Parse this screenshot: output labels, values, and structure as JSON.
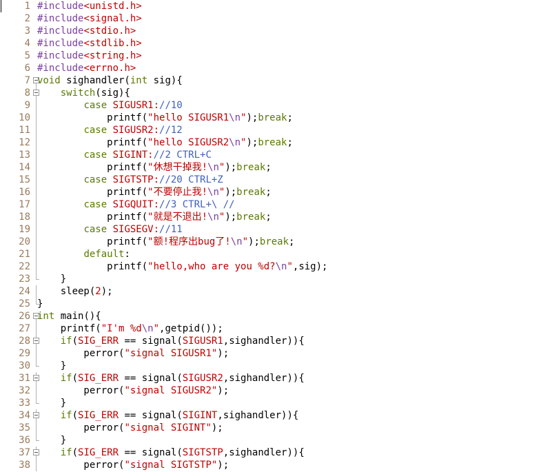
{
  "editor": {
    "lines": [
      {
        "n": "1",
        "tokens": [
          {
            "t": "#include",
            "c": "pp"
          },
          {
            "t": "<unistd.h>",
            "c": "inc"
          }
        ]
      },
      {
        "n": "2",
        "tokens": [
          {
            "t": "#include",
            "c": "pp"
          },
          {
            "t": "<signal.h>",
            "c": "inc"
          }
        ]
      },
      {
        "n": "3",
        "tokens": [
          {
            "t": "#include",
            "c": "pp"
          },
          {
            "t": "<stdio.h>",
            "c": "inc"
          }
        ]
      },
      {
        "n": "4",
        "tokens": [
          {
            "t": "#include",
            "c": "pp"
          },
          {
            "t": "<stdlib.h>",
            "c": "inc"
          }
        ]
      },
      {
        "n": "5",
        "tokens": [
          {
            "t": "#include",
            "c": "pp"
          },
          {
            "t": "<string.h>",
            "c": "inc"
          }
        ]
      },
      {
        "n": "6",
        "tokens": [
          {
            "t": "#include",
            "c": "pp"
          },
          {
            "t": "<errno.h>",
            "c": "inc"
          }
        ]
      },
      {
        "n": "7",
        "tokens": [
          {
            "t": "void",
            "c": "kw"
          },
          {
            "t": " sighandler(",
            "c": ""
          },
          {
            "t": "int",
            "c": "kw"
          },
          {
            "t": " sig){",
            "c": ""
          }
        ]
      },
      {
        "n": "8",
        "tokens": [
          {
            "t": "    ",
            "c": ""
          },
          {
            "t": "switch",
            "c": "kw"
          },
          {
            "t": "(sig){",
            "c": ""
          }
        ]
      },
      {
        "n": "9",
        "tokens": [
          {
            "t": "        ",
            "c": ""
          },
          {
            "t": "case",
            "c": "kw"
          },
          {
            "t": " SIGUSR1:",
            "c": "str"
          },
          {
            "t": "//10",
            "c": "cm"
          }
        ]
      },
      {
        "n": "10",
        "tokens": [
          {
            "t": "            printf(",
            "c": ""
          },
          {
            "t": "\"hello SIGUSR1",
            "c": "str"
          },
          {
            "t": "\\n",
            "c": "esc"
          },
          {
            "t": "\"",
            "c": "str"
          },
          {
            "t": ");",
            "c": ""
          },
          {
            "t": "break",
            "c": "kw"
          },
          {
            "t": ";",
            "c": ""
          }
        ]
      },
      {
        "n": "11",
        "tokens": [
          {
            "t": "        ",
            "c": ""
          },
          {
            "t": "case",
            "c": "kw"
          },
          {
            "t": " SIGUSR2:",
            "c": "str"
          },
          {
            "t": "//12",
            "c": "cm"
          }
        ]
      },
      {
        "n": "12",
        "tokens": [
          {
            "t": "            printf(",
            "c": ""
          },
          {
            "t": "\"hello SIGUSR2",
            "c": "str"
          },
          {
            "t": "\\n",
            "c": "esc"
          },
          {
            "t": "\"",
            "c": "str"
          },
          {
            "t": ");",
            "c": ""
          },
          {
            "t": "break",
            "c": "kw"
          },
          {
            "t": ";",
            "c": ""
          }
        ]
      },
      {
        "n": "13",
        "tokens": [
          {
            "t": "        ",
            "c": ""
          },
          {
            "t": "case",
            "c": "kw"
          },
          {
            "t": " SIGINT:",
            "c": "str"
          },
          {
            "t": "//2 CTRL+C",
            "c": "cm"
          }
        ]
      },
      {
        "n": "14",
        "tokens": [
          {
            "t": "            printf(",
            "c": ""
          },
          {
            "t": "\"休想干掉我!",
            "c": "str"
          },
          {
            "t": "\\n",
            "c": "esc"
          },
          {
            "t": "\"",
            "c": "str"
          },
          {
            "t": ");",
            "c": ""
          },
          {
            "t": "break",
            "c": "kw"
          },
          {
            "t": ";",
            "c": ""
          }
        ]
      },
      {
        "n": "15",
        "tokens": [
          {
            "t": "        ",
            "c": ""
          },
          {
            "t": "case",
            "c": "kw"
          },
          {
            "t": " SIGTSTP:",
            "c": "str"
          },
          {
            "t": "//20 CTRL+Z",
            "c": "cm"
          }
        ]
      },
      {
        "n": "16",
        "tokens": [
          {
            "t": "            printf(",
            "c": ""
          },
          {
            "t": "\"不要停止我!",
            "c": "str"
          },
          {
            "t": "\\n",
            "c": "esc"
          },
          {
            "t": "\"",
            "c": "str"
          },
          {
            "t": ");",
            "c": ""
          },
          {
            "t": "break",
            "c": "kw"
          },
          {
            "t": ";",
            "c": ""
          }
        ]
      },
      {
        "n": "17",
        "tokens": [
          {
            "t": "        ",
            "c": ""
          },
          {
            "t": "case",
            "c": "kw"
          },
          {
            "t": " SIGQUIT:",
            "c": "str"
          },
          {
            "t": "//3 CTRL+\\ //",
            "c": "cm"
          }
        ]
      },
      {
        "n": "18",
        "tokens": [
          {
            "t": "            printf(",
            "c": ""
          },
          {
            "t": "\"就是不退出!",
            "c": "str"
          },
          {
            "t": "\\n",
            "c": "esc"
          },
          {
            "t": "\"",
            "c": "str"
          },
          {
            "t": ");",
            "c": ""
          },
          {
            "t": "break",
            "c": "kw"
          },
          {
            "t": ";",
            "c": ""
          }
        ]
      },
      {
        "n": "19",
        "tokens": [
          {
            "t": "        ",
            "c": ""
          },
          {
            "t": "case",
            "c": "kw"
          },
          {
            "t": " SIGSEGV:",
            "c": "str"
          },
          {
            "t": "//11",
            "c": "cm"
          }
        ]
      },
      {
        "n": "20",
        "tokens": [
          {
            "t": "            printf(",
            "c": ""
          },
          {
            "t": "\"额!程序出bug了!",
            "c": "str"
          },
          {
            "t": "\\n",
            "c": "esc"
          },
          {
            "t": "\"",
            "c": "str"
          },
          {
            "t": ");",
            "c": ""
          },
          {
            "t": "break",
            "c": "kw"
          },
          {
            "t": ";",
            "c": ""
          }
        ]
      },
      {
        "n": "21",
        "tokens": [
          {
            "t": "        ",
            "c": ""
          },
          {
            "t": "default",
            "c": "kw"
          },
          {
            "t": ":",
            "c": ""
          }
        ]
      },
      {
        "n": "22",
        "tokens": [
          {
            "t": "            printf(",
            "c": ""
          },
          {
            "t": "\"hello,who are you %d?",
            "c": "str"
          },
          {
            "t": "\\n",
            "c": "esc"
          },
          {
            "t": "\"",
            "c": "str"
          },
          {
            "t": ",sig);",
            "c": ""
          }
        ]
      },
      {
        "n": "23",
        "tokens": [
          {
            "t": "    }",
            "c": ""
          }
        ]
      },
      {
        "n": "24",
        "tokens": [
          {
            "t": "    sleep(",
            "c": ""
          },
          {
            "t": "2",
            "c": "num"
          },
          {
            "t": ");",
            "c": ""
          }
        ]
      },
      {
        "n": "25",
        "tokens": [
          {
            "t": "}",
            "c": ""
          }
        ]
      },
      {
        "n": "26",
        "tokens": [
          {
            "t": "int",
            "c": "kw"
          },
          {
            "t": " main(){",
            "c": ""
          }
        ]
      },
      {
        "n": "27",
        "tokens": [
          {
            "t": "    printf(",
            "c": ""
          },
          {
            "t": "\"I'm %d",
            "c": "str"
          },
          {
            "t": "\\n",
            "c": "esc"
          },
          {
            "t": "\"",
            "c": "str"
          },
          {
            "t": ",getpid());",
            "c": ""
          }
        ]
      },
      {
        "n": "28",
        "tokens": [
          {
            "t": "    ",
            "c": ""
          },
          {
            "t": "if",
            "c": "kw"
          },
          {
            "t": "(",
            "c": ""
          },
          {
            "t": "SIG_ERR",
            "c": "str"
          },
          {
            "t": " == signal(",
            "c": ""
          },
          {
            "t": "SIGUSR1",
            "c": "str"
          },
          {
            "t": ",sighandler)){",
            "c": ""
          }
        ]
      },
      {
        "n": "29",
        "tokens": [
          {
            "t": "        perror(",
            "c": ""
          },
          {
            "t": "\"signal SIGUSR1\"",
            "c": "str"
          },
          {
            "t": ");",
            "c": ""
          }
        ]
      },
      {
        "n": "30",
        "tokens": [
          {
            "t": "    }",
            "c": ""
          }
        ]
      },
      {
        "n": "31",
        "tokens": [
          {
            "t": "    ",
            "c": ""
          },
          {
            "t": "if",
            "c": "kw"
          },
          {
            "t": "(",
            "c": ""
          },
          {
            "t": "SIG_ERR",
            "c": "str"
          },
          {
            "t": " == signal(",
            "c": ""
          },
          {
            "t": "SIGUSR2",
            "c": "str"
          },
          {
            "t": ",sighandler)){",
            "c": ""
          }
        ]
      },
      {
        "n": "32",
        "tokens": [
          {
            "t": "        perror(",
            "c": ""
          },
          {
            "t": "\"signal SIGUSR2\"",
            "c": "str"
          },
          {
            "t": ");",
            "c": ""
          }
        ]
      },
      {
        "n": "33",
        "tokens": [
          {
            "t": "    }",
            "c": ""
          }
        ]
      },
      {
        "n": "34",
        "tokens": [
          {
            "t": "    ",
            "c": ""
          },
          {
            "t": "if",
            "c": "kw"
          },
          {
            "t": "(",
            "c": ""
          },
          {
            "t": "SIG_ERR",
            "c": "str"
          },
          {
            "t": " == signal(",
            "c": ""
          },
          {
            "t": "SIGINT",
            "c": "str"
          },
          {
            "t": ",sighandler)){",
            "c": ""
          }
        ]
      },
      {
        "n": "35",
        "tokens": [
          {
            "t": "        perror(",
            "c": ""
          },
          {
            "t": "\"signal SIGINT\"",
            "c": "str"
          },
          {
            "t": ");",
            "c": ""
          }
        ]
      },
      {
        "n": "36",
        "tokens": [
          {
            "t": "    }",
            "c": ""
          }
        ]
      },
      {
        "n": "37",
        "tokens": [
          {
            "t": "    ",
            "c": ""
          },
          {
            "t": "if",
            "c": "kw"
          },
          {
            "t": "(",
            "c": ""
          },
          {
            "t": "SIG_ERR",
            "c": "str"
          },
          {
            "t": " == signal(",
            "c": ""
          },
          {
            "t": "SIGTSTP",
            "c": "str"
          },
          {
            "t": ",sighandler)){",
            "c": ""
          }
        ]
      },
      {
        "n": "38",
        "tokens": [
          {
            "t": "        perror(",
            "c": ""
          },
          {
            "t": "\"signal SIGTSTP\"",
            "c": "str"
          },
          {
            "t": ");",
            "c": ""
          }
        ]
      }
    ]
  },
  "colors": {
    "background": "#ffffff",
    "line_number": "#9a7a5a",
    "preprocessor": "#7a3fa0",
    "keyword": "#5a7a00",
    "string": "#c00000",
    "comment": "#4060b8",
    "escape": "#7a3fa0"
  }
}
